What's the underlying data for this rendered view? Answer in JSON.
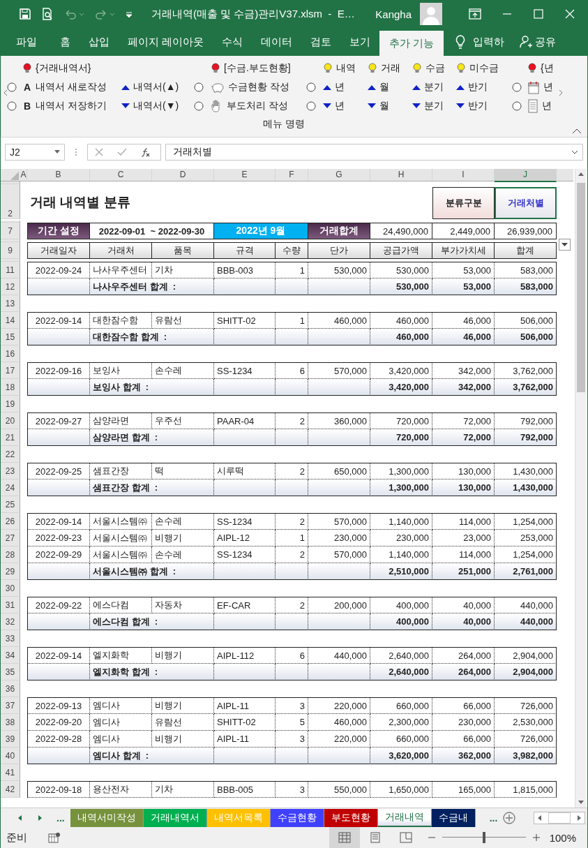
{
  "title_bar": {
    "title": "거래내역(매출 및 수금)관리V37.xlsm  -  E…",
    "user": "Kangha"
  },
  "ribbon_tabs": [
    {
      "label": "파일",
      "selected": false
    },
    {
      "label": "홈",
      "selected": false
    },
    {
      "label": "삽입",
      "selected": false
    },
    {
      "label": "페이지 레이아웃",
      "selected": false
    },
    {
      "label": "수식",
      "selected": false
    },
    {
      "label": "데이터",
      "selected": false
    },
    {
      "label": "검토",
      "selected": false
    },
    {
      "label": "보기",
      "selected": false
    },
    {
      "label": "추가 기능",
      "selected": true
    }
  ],
  "tell_me": "입력하",
  "share": "공유",
  "ribbon": {
    "columns": [
      {
        "middle": {
          "kind": "radio",
          "selected": false
        },
        "bottom": {
          "kind": "radio",
          "selected": false
        }
      },
      {
        "top": {
          "kind": "bulb",
          "color": "#e81123",
          "label": "{거래내역서}"
        },
        "middle": {
          "kind": "key",
          "key": "A",
          "label": "내역서 새로작성"
        },
        "bottom": {
          "kind": "key",
          "key": "B",
          "label": "내역서 저장하기"
        }
      },
      {
        "middle": {
          "kind": "up",
          "label": "내역서(▲)"
        },
        "bottom": {
          "kind": "down",
          "label": "내역서(▼)"
        }
      },
      {
        "middle": {
          "kind": "radio",
          "selected": false
        },
        "bottom": {
          "kind": "radio",
          "selected": false
        }
      },
      {
        "top": {
          "kind": "bulb",
          "color": "#e81123",
          "label": "[수금.부도현황]"
        },
        "middle": {
          "kind": "pig",
          "label": "수금현황 작성"
        },
        "bottom": {
          "kind": "hand",
          "label": "부도처리 작성"
        }
      },
      {
        "middle": {
          "kind": "radio",
          "selected": false
        },
        "bottom": {
          "kind": "radio",
          "selected": false
        }
      },
      {
        "top": {
          "kind": "bulb",
          "color": "#f5e51b",
          "label": "내역"
        },
        "middle": {
          "kind": "up",
          "label": "년"
        },
        "bottom": {
          "kind": "down",
          "label": "년"
        }
      },
      {
        "top": {
          "kind": "bulb",
          "color": "#f5e51b",
          "label": "거래"
        },
        "middle": {
          "kind": "up",
          "label": "월"
        },
        "bottom": {
          "kind": "down",
          "label": "월"
        }
      },
      {
        "top": {
          "kind": "bulb",
          "color": "#f5e51b",
          "label": "수금"
        },
        "middle": {
          "kind": "up",
          "label": "분기"
        },
        "bottom": {
          "kind": "down",
          "label": "분기"
        }
      },
      {
        "top": {
          "kind": "bulb",
          "color": "#f5e51b",
          "label": "미수금"
        },
        "middle": {
          "kind": "up",
          "label": "반기"
        },
        "bottom": {
          "kind": "down",
          "label": "반기"
        }
      },
      {
        "middle": {
          "kind": "radio",
          "selected": false
        },
        "bottom": {
          "kind": "radio",
          "selected": false
        }
      },
      {
        "top": {
          "kind": "bulb",
          "color": "#e81123",
          "label": "{년"
        },
        "middle": {
          "kind": "calendar",
          "label": "년"
        },
        "bottom": {
          "kind": "doc",
          "label": "년"
        }
      }
    ],
    "group_label": "메뉴 명령"
  },
  "formula_bar": {
    "name_box": "J2",
    "formula": "거래처별"
  },
  "columns": [
    {
      "label": "A",
      "selected": false
    },
    {
      "label": "B",
      "selected": false
    },
    {
      "label": "C",
      "selected": false
    },
    {
      "label": "D",
      "selected": false
    },
    {
      "label": "E",
      "selected": false
    },
    {
      "label": "F",
      "selected": false
    },
    {
      "label": "G",
      "selected": false
    },
    {
      "label": "H",
      "selected": false
    },
    {
      "label": "I",
      "selected": false
    },
    {
      "label": "J",
      "selected": true
    }
  ],
  "sheet": {
    "title_row": "2",
    "title": "거래 내역별 분류",
    "category_label": "분류구분",
    "category_value": "거래처별",
    "period_row": "7",
    "period_label": "기간 설정",
    "period_range": "2022-09-01  ~ 2022-09-30",
    "period_month": "2022년 9월",
    "total_label": "거래합계",
    "totals": [
      "24,490,000",
      "2,449,000",
      "26,939,000"
    ],
    "header_row": "9",
    "headers": [
      "거래일자",
      "거래처",
      "품목",
      "규격",
      "수량",
      "단가",
      "공급가액",
      "부가가치세",
      "합계"
    ],
    "rows": [
      {
        "kind": "data",
        "num": "11",
        "cells": [
          "2022-09-24",
          "나사우주센터",
          "기차",
          "BBB-003",
          "1",
          "530,000",
          "530,000",
          "53,000",
          "583,000"
        ]
      },
      {
        "kind": "subtotal",
        "num": "12",
        "label": "나사우주센터 합계  :",
        "amounts": [
          "530,000",
          "53,000",
          "583,000"
        ]
      },
      {
        "kind": "blank",
        "num": "13"
      },
      {
        "kind": "data",
        "num": "14",
        "cells": [
          "2022-09-14",
          "대한잠수함",
          "유람선",
          "SHITT-02",
          "1",
          "460,000",
          "460,000",
          "46,000",
          "506,000"
        ]
      },
      {
        "kind": "subtotal",
        "num": "15",
        "label": "대한잠수함 합계  :",
        "amounts": [
          "460,000",
          "46,000",
          "506,000"
        ]
      },
      {
        "kind": "blank",
        "num": "16"
      },
      {
        "kind": "data",
        "num": "17",
        "cells": [
          "2022-09-16",
          "보잉사",
          "손수레",
          "SS-1234",
          "6",
          "570,000",
          "3,420,000",
          "342,000",
          "3,762,000"
        ]
      },
      {
        "kind": "subtotal",
        "num": "18",
        "label": "보잉사 합계  :",
        "amounts": [
          "3,420,000",
          "342,000",
          "3,762,000"
        ]
      },
      {
        "kind": "blank",
        "num": "19"
      },
      {
        "kind": "data",
        "num": "20",
        "cells": [
          "2022-09-27",
          "삼양라면",
          "우주선",
          "PAAR-04",
          "2",
          "360,000",
          "720,000",
          "72,000",
          "792,000"
        ]
      },
      {
        "kind": "subtotal",
        "num": "21",
        "label": "삼양라면 합계  :",
        "amounts": [
          "720,000",
          "72,000",
          "792,000"
        ]
      },
      {
        "kind": "blank",
        "num": "22"
      },
      {
        "kind": "data",
        "num": "23",
        "cells": [
          "2022-09-25",
          "샘표간장",
          "떡",
          "시루떡",
          "2",
          "650,000",
          "1,300,000",
          "130,000",
          "1,430,000"
        ]
      },
      {
        "kind": "subtotal",
        "num": "24",
        "label": "샘표간장 합계  :",
        "amounts": [
          "1,300,000",
          "130,000",
          "1,430,000"
        ]
      },
      {
        "kind": "blank",
        "num": "25"
      },
      {
        "kind": "data",
        "num": "26",
        "cells": [
          "2022-09-14",
          "서울시스템㈜",
          "손수레",
          "SS-1234",
          "2",
          "570,000",
          "1,140,000",
          "114,000",
          "1,254,000"
        ]
      },
      {
        "kind": "data",
        "num": "27",
        "cells": [
          "2022-09-23",
          "서울시스템㈜",
          "비행기",
          "AIPL-12",
          "1",
          "230,000",
          "230,000",
          "23,000",
          "253,000"
        ]
      },
      {
        "kind": "data",
        "num": "28",
        "cells": [
          "2022-09-29",
          "서울시스템㈜",
          "손수레",
          "SS-1234",
          "2",
          "570,000",
          "1,140,000",
          "114,000",
          "1,254,000"
        ]
      },
      {
        "kind": "subtotal",
        "num": "29",
        "label": "서울시스템㈜ 합계  :",
        "amounts": [
          "2,510,000",
          "251,000",
          "2,761,000"
        ]
      },
      {
        "kind": "blank",
        "num": "30"
      },
      {
        "kind": "data",
        "num": "31",
        "cells": [
          "2022-09-22",
          "에스다컴",
          "자동차",
          "EF-CAR",
          "2",
          "200,000",
          "400,000",
          "40,000",
          "440,000"
        ]
      },
      {
        "kind": "subtotal",
        "num": "32",
        "label": "에스다컴 합계  :",
        "amounts": [
          "400,000",
          "40,000",
          "440,000"
        ]
      },
      {
        "kind": "blank",
        "num": "33"
      },
      {
        "kind": "data",
        "num": "34",
        "cells": [
          "2022-09-14",
          "엘지화학",
          "비행기",
          "AIPL-112",
          "6",
          "440,000",
          "2,640,000",
          "264,000",
          "2,904,000"
        ]
      },
      {
        "kind": "subtotal",
        "num": "35",
        "label": "엘지화학 합계  :",
        "amounts": [
          "2,640,000",
          "264,000",
          "2,904,000"
        ]
      },
      {
        "kind": "blank",
        "num": "36"
      },
      {
        "kind": "data",
        "num": "37",
        "cells": [
          "2022-09-13",
          "엠디사",
          "비행기",
          "AIPL-11",
          "3",
          "220,000",
          "660,000",
          "66,000",
          "726,000"
        ]
      },
      {
        "kind": "data",
        "num": "38",
        "cells": [
          "2022-09-20",
          "엠디사",
          "유람선",
          "SHITT-02",
          "5",
          "460,000",
          "2,300,000",
          "230,000",
          "2,530,000"
        ]
      },
      {
        "kind": "data",
        "num": "39",
        "cells": [
          "2022-09-28",
          "엠디사",
          "비행기",
          "AIPL-11",
          "3",
          "220,000",
          "660,000",
          "66,000",
          "726,000"
        ]
      },
      {
        "kind": "subtotal",
        "num": "40",
        "label": "엠디사 합계  :",
        "amounts": [
          "3,620,000",
          "362,000",
          "3,982,000"
        ]
      },
      {
        "kind": "blank",
        "num": "41"
      },
      {
        "kind": "data",
        "num": "42",
        "cells": [
          "2022-09-18",
          "용산전자",
          "기차",
          "BBB-005",
          "3",
          "550,000",
          "1,650,000",
          "165,000",
          "1,815,000"
        ]
      }
    ]
  },
  "sheet_tabs": {
    "more_left": "...",
    "tabs": [
      {
        "label": "내역서미작성",
        "color": "#76923c",
        "selected": false
      },
      {
        "label": "거래내역서",
        "color": "#00b050",
        "selected": false
      },
      {
        "label": "내역서목록",
        "color": "#ffc000",
        "selected": false
      },
      {
        "label": "수금현황",
        "color": "#4040ff",
        "selected": false
      },
      {
        "label": "부도현황",
        "color": "#c00000",
        "selected": false
      },
      {
        "label": "거래내역",
        "color": "#ffffff",
        "selected": true
      },
      {
        "label": "수금내",
        "color": "#002060",
        "selected": false
      }
    ],
    "more_right": "..."
  },
  "status_bar": {
    "status": "준비",
    "views": [
      {
        "kind": "normal",
        "selected": true
      },
      {
        "kind": "page_layout",
        "selected": false
      },
      {
        "kind": "page_break",
        "selected": false
      }
    ],
    "zoom": {
      "level": 0.5
    },
    "zoom_label": "100%"
  }
}
